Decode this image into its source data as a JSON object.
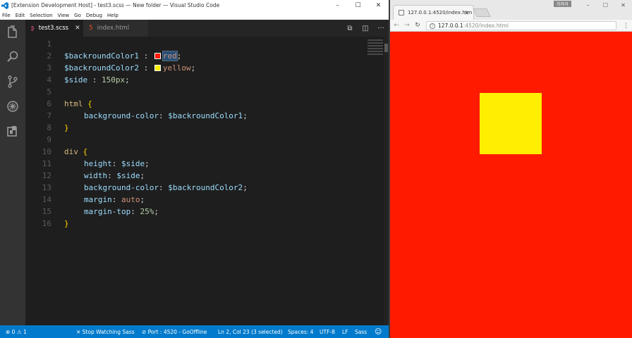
{
  "vscode": {
    "title": "[Extension Development Host] - test3.scss — New folder — Visual Studio Code",
    "menu": [
      "File",
      "Edit",
      "Selection",
      "View",
      "Go",
      "Debug",
      "Help"
    ],
    "tabs": [
      {
        "label": "test3.scss",
        "icon": "scss-file-icon",
        "active": true
      },
      {
        "label": "index.html",
        "icon": "html-file-icon",
        "active": false
      }
    ],
    "line_numbers": [
      "1",
      "2",
      "3",
      "4",
      "5",
      "6",
      "7",
      "8",
      "9",
      "10",
      "11",
      "12",
      "13",
      "14",
      "15",
      "16"
    ],
    "code": {
      "l2": {
        "var": "$backroundColor1",
        "sep": " : ",
        "val": "red",
        "end": ";",
        "swatch": "#ff1a00"
      },
      "l3": {
        "var": "$backroundColor2",
        "sep": " : ",
        "val": "yellow",
        "end": ";",
        "swatch": "#ffee00"
      },
      "l4": {
        "var": "$side",
        "sep": " : ",
        "val": "150px",
        "end": ";"
      },
      "l6": {
        "sel": "html",
        "brace": " {"
      },
      "l7": {
        "prop": "background-color",
        "colon": ": ",
        "val": "$backroundColor1",
        "end": ";"
      },
      "l8": {
        "brace": "}"
      },
      "l10": {
        "sel": "div",
        "brace": " {"
      },
      "l11": {
        "prop": "height",
        "colon": ": ",
        "val": "$side",
        "end": ";"
      },
      "l12": {
        "prop": "width",
        "colon": ": ",
        "val": "$side",
        "end": ";"
      },
      "l13": {
        "prop": "background-color",
        "colon": ": ",
        "val": "$backroundColor2",
        "end": ";"
      },
      "l14": {
        "prop": "margin",
        "colon": ": ",
        "val": "auto",
        "end": ";"
      },
      "l15": {
        "prop": "margin-top",
        "colon": ": ",
        "val": "25%",
        "end": ";"
      },
      "l16": {
        "brace": "}"
      }
    },
    "status": {
      "errors": "0",
      "warnings": "1",
      "watch": "Stop Watching Sass",
      "port": "Port : 4520 - GoOffline",
      "position": "Ln 2, Col 23 (3 selected)",
      "spaces": "Spaces: 4",
      "encoding": "UTF-8",
      "eol": "LF",
      "language": "Sass"
    },
    "colors": {
      "statusbar": "#007acc",
      "editor_bg": "#1e1e1e",
      "activitybar": "#333333"
    }
  },
  "browser": {
    "tab_title": "127.0.0.1:4520/index.htm",
    "user_badge": "치카리",
    "url_host": "127.0.0.1",
    "url_path": ":4520/index.html",
    "page_bg": "#ff1a00",
    "box_color": "#ffee00"
  }
}
